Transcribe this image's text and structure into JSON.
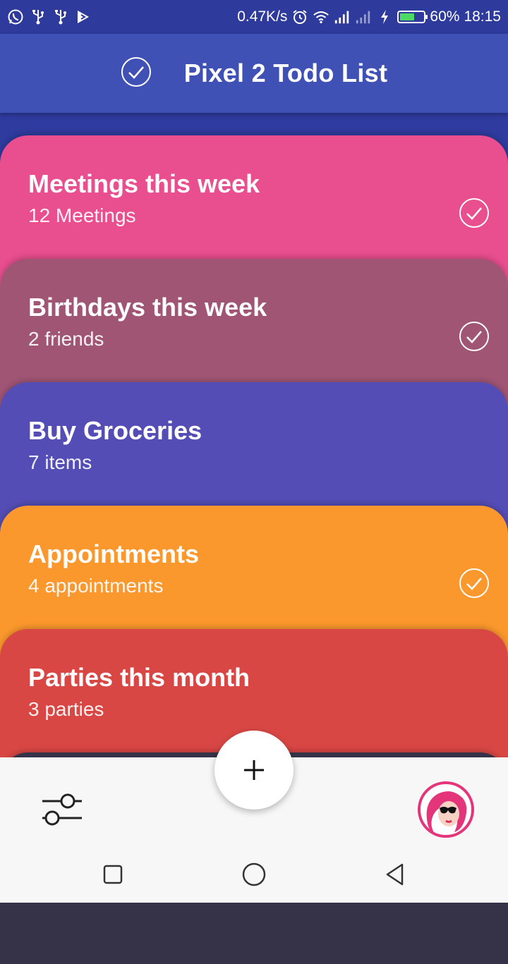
{
  "status_bar": {
    "left_icons": [
      "whatsapp-icon",
      "usb-icon",
      "usb-icon",
      "notification-icon"
    ],
    "network_speed": "0.47K/s",
    "battery": "60%",
    "battery_level": 0.6,
    "time": "18:15"
  },
  "app_bar": {
    "title": "Pixel 2 Todo List",
    "icon": "check-circle-icon"
  },
  "cards": [
    {
      "title": "Meetings this week",
      "subtitle": "12 Meetings",
      "color": "#e94e8e",
      "checked": true
    },
    {
      "title": "Birthdays this week",
      "subtitle": "2 friends",
      "color": "#a05574",
      "checked": true
    },
    {
      "title": "Buy Groceries",
      "subtitle": "7 items",
      "color": "#544db5",
      "checked": false
    },
    {
      "title": "Appointments",
      "subtitle": "4 appointments",
      "color": "#fb982d",
      "checked": true
    },
    {
      "title": "Parties this month",
      "subtitle": "3 parties",
      "color": "#d94744",
      "checked": false
    },
    {
      "title": "",
      "subtitle": "",
      "color": "#363248",
      "checked": false
    }
  ],
  "bottom_bar": {
    "left_icon": "sliders-icon",
    "fab_icon": "plus-icon",
    "avatar_icon": "avatar-icon"
  },
  "nav_bar": [
    "recents-square-icon",
    "home-circle-icon",
    "back-triangle-icon"
  ]
}
